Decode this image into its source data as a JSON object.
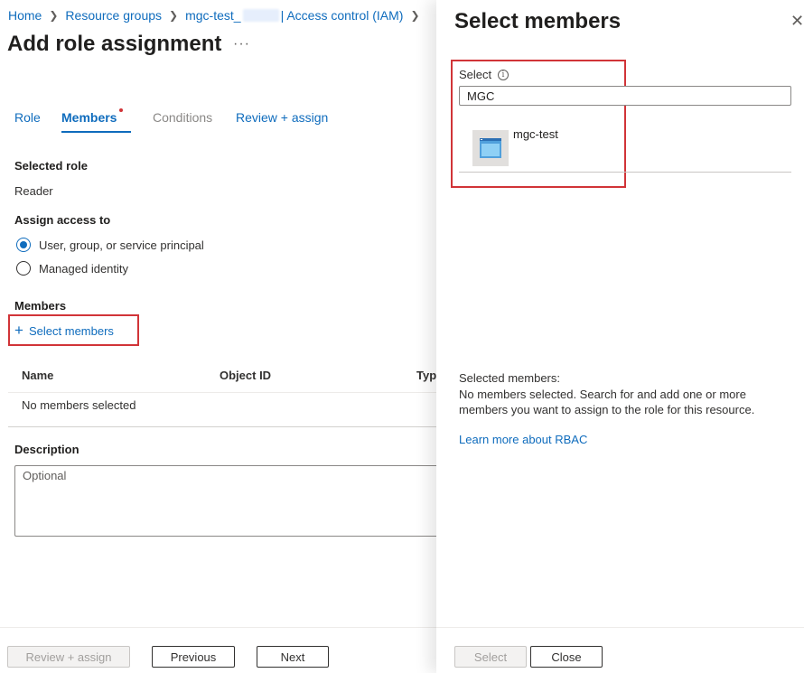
{
  "breadcrumb": {
    "home": "Home",
    "resource_groups": "Resource groups",
    "resource_prefix": "mgc-test_",
    "resource_suffix": "| Access control (IAM)"
  },
  "page": {
    "title": "Add role assignment",
    "more": "···"
  },
  "tabs": [
    {
      "label": "Role"
    },
    {
      "label": "Members"
    },
    {
      "label": "Conditions"
    },
    {
      "label": "Review + assign"
    }
  ],
  "selected_role": {
    "label": "Selected role",
    "value": "Reader"
  },
  "assign_access": {
    "label": "Assign access to",
    "options": [
      {
        "label": "User, group, or service principal",
        "selected": true
      },
      {
        "label": "Managed identity",
        "selected": false
      }
    ]
  },
  "members": {
    "label": "Members",
    "select_link": "Select members",
    "plus": "+",
    "columns": [
      "Name",
      "Object ID",
      "Type"
    ],
    "empty": "No members selected"
  },
  "description": {
    "label": "Description",
    "placeholder": "Optional"
  },
  "footer": {
    "review_assign": "Review + assign",
    "previous": "Previous",
    "next": "Next"
  },
  "panel": {
    "title": "Select members",
    "close": "✕",
    "select_label": "Select",
    "info": "i",
    "search_value": "MGC",
    "results": [
      {
        "name": "mgc-test"
      }
    ],
    "selected_heading": "Selected members:",
    "selected_text": "No members selected. Search for and add one or more members you want to assign to the role for this resource.",
    "learn_more": "Learn more about RBAC",
    "select_button": "Select",
    "close_button": "Close"
  },
  "colors": {
    "accent": "#0f6cbd",
    "highlight_box": "#d13438",
    "required_dot": "#d13438"
  }
}
